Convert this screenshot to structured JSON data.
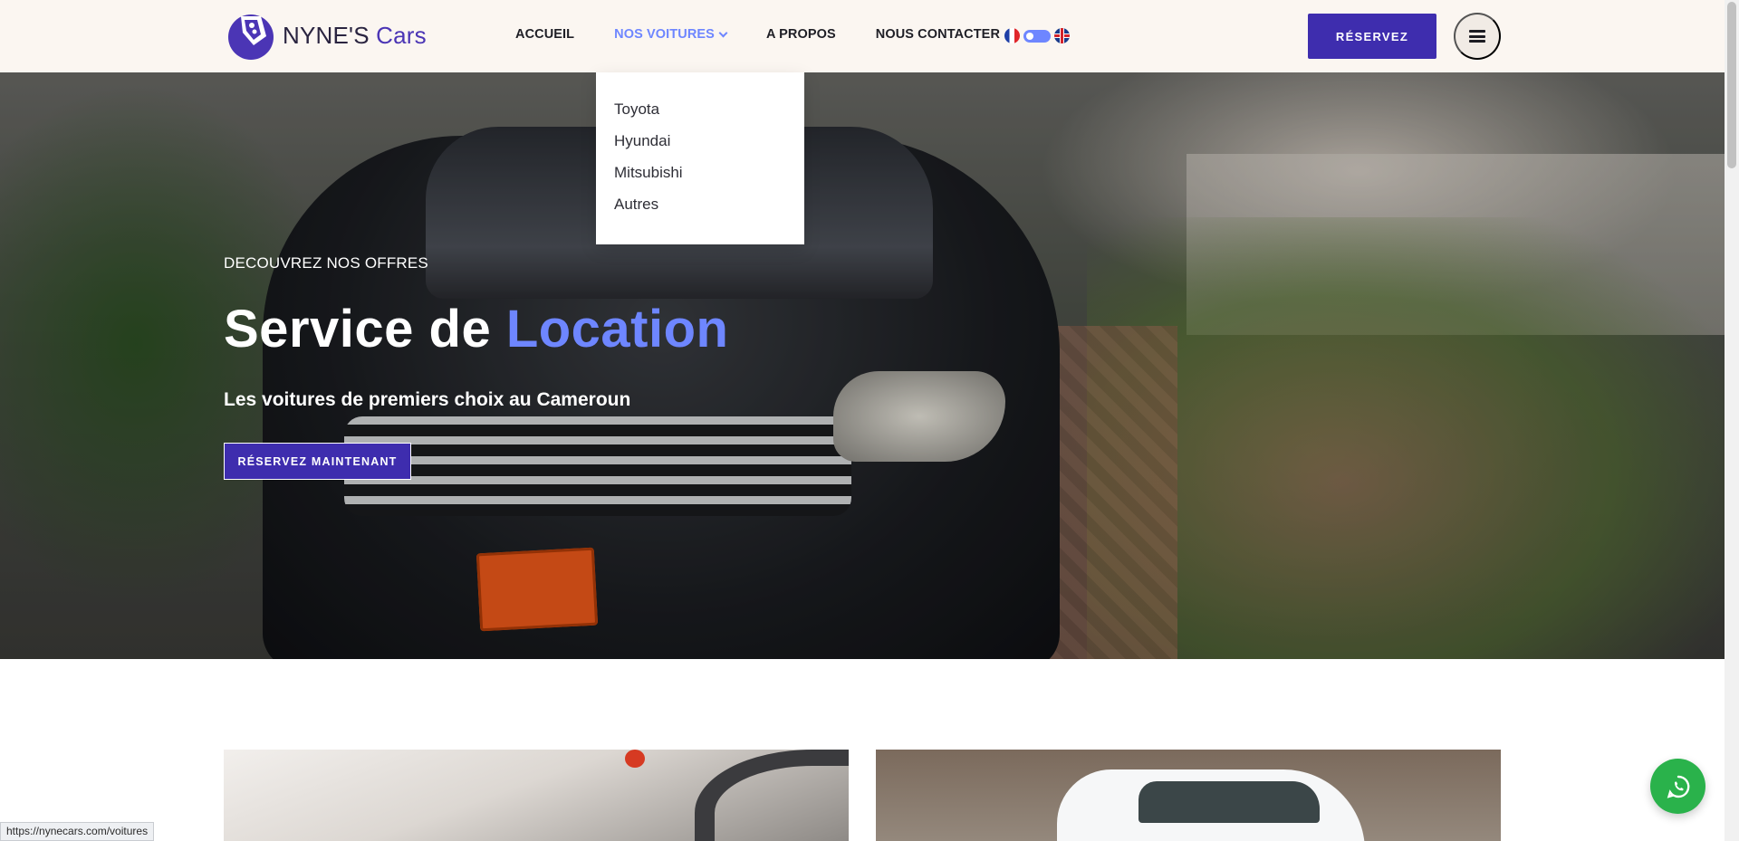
{
  "header": {
    "logo_text_main": "NYNE'S ",
    "logo_text_accent": "Cars",
    "nav": [
      {
        "label": "ACCUEIL"
      },
      {
        "label": "NOS VOITURES"
      },
      {
        "label": "A PROPOS"
      },
      {
        "label": "NOUS CONTACTER"
      }
    ],
    "reserve_label": "RÉSERVEZ",
    "accent_color": "#6e86ff",
    "brand_color": "#3e2dae"
  },
  "dropdown": {
    "items": [
      "Toyota",
      "Hyundai",
      "Mitsubishi",
      "Autres"
    ]
  },
  "hero": {
    "kicker": "DECOUVREZ NOS OFFRES",
    "title_main": "Service de ",
    "title_accent": "Location",
    "subtitle": "Les voitures de premiers choix au Cameroun",
    "cta_label": "RÉSERVEZ MAINTENANT"
  },
  "status_url": "https://nynecars.com/voitures"
}
